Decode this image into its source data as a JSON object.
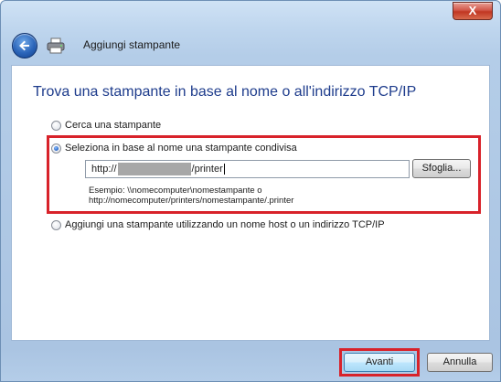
{
  "window": {
    "title": "Aggiungi stampante",
    "close_label": "X"
  },
  "main": {
    "heading": "Trova una stampante in base al nome o all'indirizzo TCP/IP",
    "options": [
      {
        "label": "Cerca una stampante",
        "checked": false
      },
      {
        "label": "Seleziona in base al nome una stampante condivisa",
        "checked": true
      },
      {
        "label": "Aggiungi una stampante utilizzando un nome host o un indirizzo TCP/IP",
        "checked": false
      }
    ],
    "path_input": {
      "prefix": "http://",
      "suffix": "/printer"
    },
    "browse_label": "Sfoglia...",
    "example_line1": "Esempio: \\\\nomecomputer\\nomestampante o",
    "example_line2": "http://nomecomputer/printers/nomestampante/.printer"
  },
  "footer": {
    "next_label": "Avanti",
    "cancel_label": "Annulla"
  },
  "colors": {
    "heading": "#1e3c8c",
    "highlight": "#d8222a"
  },
  "icons": [
    "back-arrow-icon",
    "printer-icon",
    "close-icon"
  ]
}
